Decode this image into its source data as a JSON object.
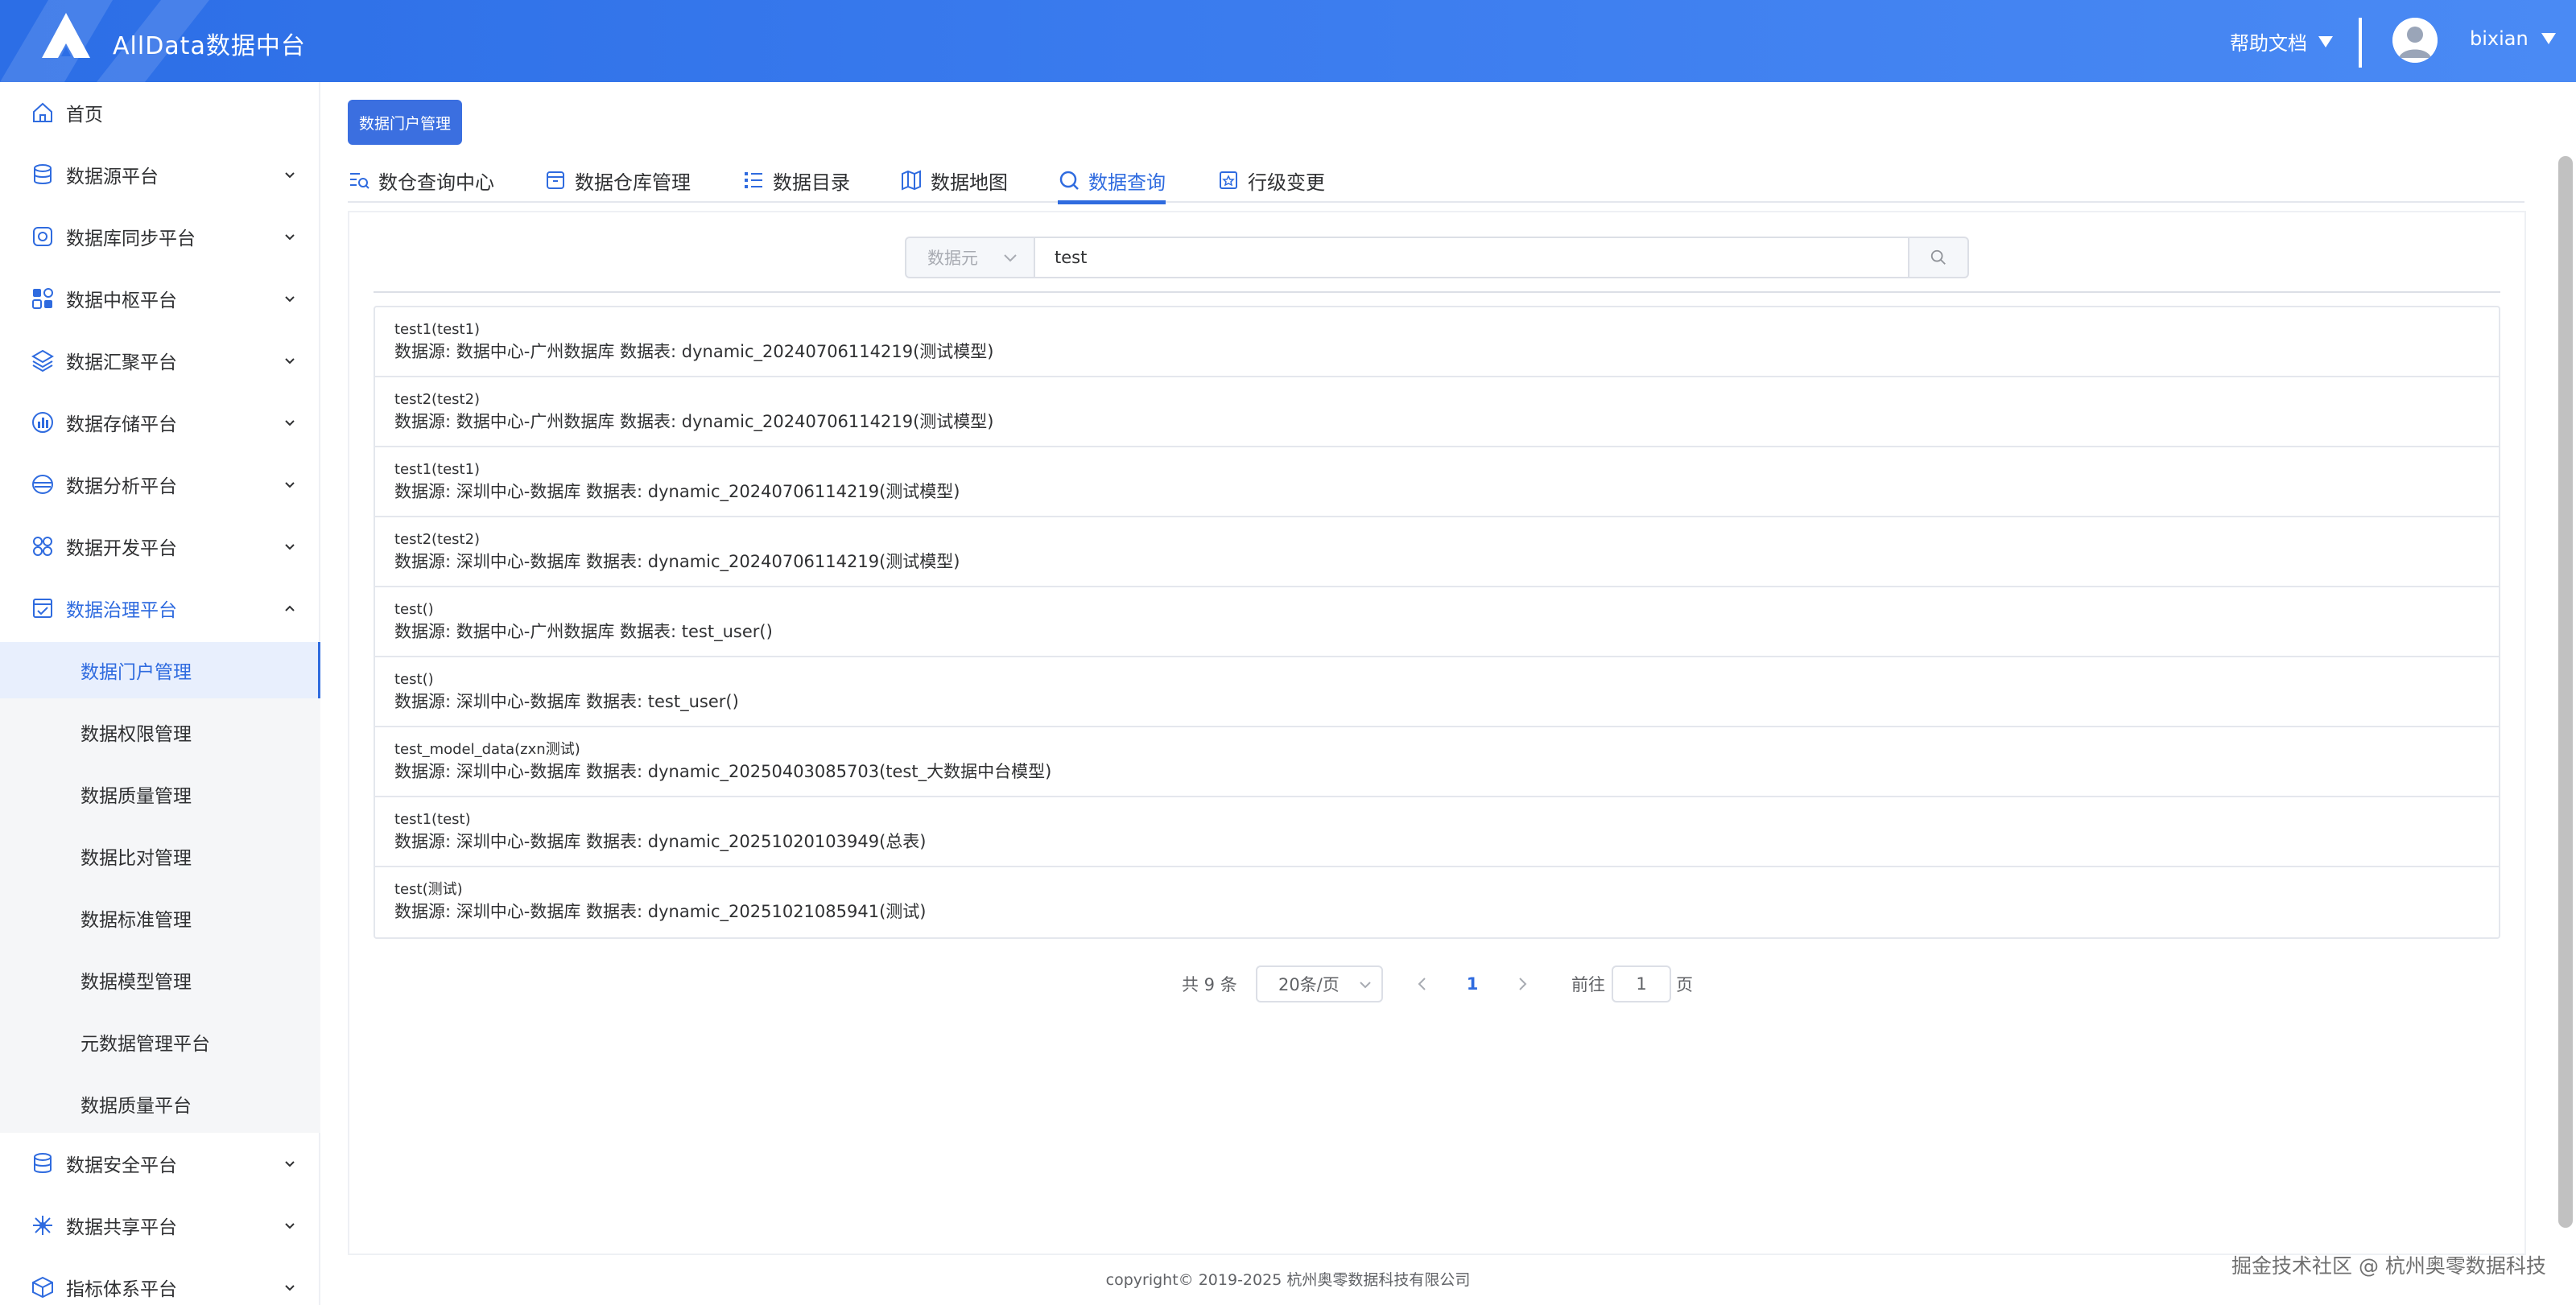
{
  "app": {
    "title": "AllData数据中台"
  },
  "header": {
    "help_label": "帮助文档",
    "username": "bixian"
  },
  "sidebar": {
    "items": [
      {
        "label": "首页",
        "icon": "home-icon"
      },
      {
        "label": "数据源平台",
        "icon": "database-icon"
      },
      {
        "label": "数据库同步平台",
        "icon": "sync-icon"
      },
      {
        "label": "数据中枢平台",
        "icon": "grid-icon"
      },
      {
        "label": "数据汇聚平台",
        "icon": "layers-icon"
      },
      {
        "label": "数据存储平台",
        "icon": "storage-icon"
      },
      {
        "label": "数据分析平台",
        "icon": "analysis-icon"
      },
      {
        "label": "数据开发平台",
        "icon": "dev-icon"
      },
      {
        "label": "数据治理平台",
        "icon": "governance-icon"
      },
      {
        "label": "数据安全平台",
        "icon": "security-icon"
      },
      {
        "label": "数据共享平台",
        "icon": "share-icon"
      },
      {
        "label": "指标体系平台",
        "icon": "metrics-icon"
      }
    ],
    "submenu": [
      {
        "label": "数据门户管理"
      },
      {
        "label": "数据权限管理"
      },
      {
        "label": "数据质量管理"
      },
      {
        "label": "数据比对管理"
      },
      {
        "label": "数据标准管理"
      },
      {
        "label": "数据模型管理"
      },
      {
        "label": "元数据管理平台"
      },
      {
        "label": "数据质量平台"
      }
    ]
  },
  "main": {
    "portal_button": "数据门户管理",
    "tabs": [
      {
        "label": "数仓查询中心"
      },
      {
        "label": "数据仓库管理"
      },
      {
        "label": "数据目录"
      },
      {
        "label": "数据地图"
      },
      {
        "label": "数据查询"
      },
      {
        "label": "行级变更"
      }
    ],
    "search": {
      "type": "数据元",
      "value": "test"
    },
    "results": [
      {
        "title": "test1(test1)",
        "desc": "数据源: 数据中心-广州数据库 数据表: dynamic_20240706114219(测试模型)"
      },
      {
        "title": "test2(test2)",
        "desc": "数据源: 数据中心-广州数据库 数据表: dynamic_20240706114219(测试模型)"
      },
      {
        "title": "test1(test1)",
        "desc": "数据源: 深圳中心-数据库 数据表: dynamic_20240706114219(测试模型)"
      },
      {
        "title": "test2(test2)",
        "desc": "数据源: 深圳中心-数据库 数据表: dynamic_20240706114219(测试模型)"
      },
      {
        "title": "test()",
        "desc": "数据源: 数据中心-广州数据库 数据表: test_user()"
      },
      {
        "title": "test()",
        "desc": "数据源: 深圳中心-数据库 数据表: test_user()"
      },
      {
        "title": "test_model_data(zxn测试)",
        "desc": "数据源: 深圳中心-数据库 数据表: dynamic_20250403085703(test_大数据中台模型)"
      },
      {
        "title": "test1(test)",
        "desc": "数据源: 深圳中心-数据库 数据表: dynamic_20251020103949(总表)"
      },
      {
        "title": "test(测试)",
        "desc": "数据源: 深圳中心-数据库 数据表: dynamic_20251021085941(测试)"
      }
    ],
    "pagination": {
      "total": "共 9 条",
      "page_size": "20条/页",
      "current_page": "1",
      "goto_prefix": "前往",
      "goto_value": "1",
      "goto_suffix": "页"
    }
  },
  "footer": {
    "copyright": "copyright© 2019-2025 杭州奥零数据科技有限公司"
  },
  "watermark": "掘金技术社区 @ 杭州奥零数据科技",
  "colors": {
    "primary": "#2f6bdf",
    "header": "#3a7bee",
    "submenu_bg": "#f5f6f8"
  }
}
